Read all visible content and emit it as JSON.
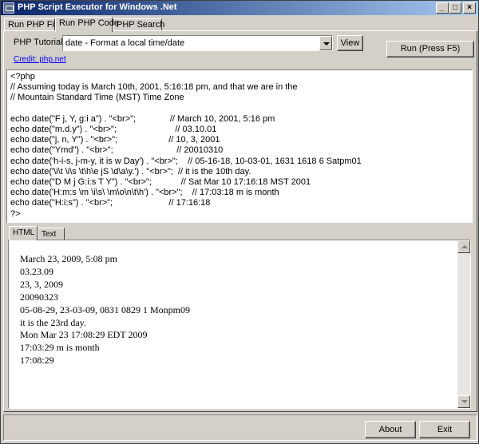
{
  "window": {
    "title": "PHP Script Executor for Windows .Net"
  },
  "titlebar_buttons": {
    "minimize": "_",
    "maximize": "□",
    "close": "×"
  },
  "tabs": [
    "Run PHP File",
    "Run PHP Code",
    "PHP Search"
  ],
  "tutorials": {
    "label": "PHP Tutorials",
    "selected": "date - Format a local time/date",
    "view_button": "View",
    "credit_link": "Credit: php.net"
  },
  "run_button": "Run (Press F5)",
  "code": "<?php\n// Assuming today is March 10th, 2001, 5:16:18 pm, and that we are in the\n// Mountain Standard Time (MST) Time Zone\n\necho date(\"F j, Y, g:i a\") . \"<br>\";              // March 10, 2001, 5:16 pm\necho date(\"m.d.y\") . \"<br>\";                        // 03.10.01\necho date(\"j, n, Y\") . \"<br>\";                     // 10, 3, 2001\necho date(\"Ymd\") . \"<br>\";                          // 20010310\necho date('h-i-s, j-m-y, it is w Day') . \"<br>\";    // 05-16-18, 10-03-01, 1631 1618 6 Satpm01\necho date('\\i\\t \\i\\s \\t\\h\\e jS \\d\\a\\y.') . \"<br>\";  // it is the 10th day.\necho date(\"D M j G:i:s T Y\") . \"<br>\";            // Sat Mar 10 17:16:18 MST 2001\necho date('H:m:s \\m \\i\\s\\ \\m\\o\\n\\t\\h') . \"<br>\";    // 17:03:18 m is month\necho date(\"H:i:s\") . \"<br>\";                       // 17:16:18\n?>",
  "output_tabs": [
    "HTML",
    "Text"
  ],
  "output_lines": [
    "March 23, 2009, 5:08 pm",
    "03.23.09",
    "23, 3, 2009",
    "20090323",
    "05-08-29, 23-03-09, 0831 0829 1 Monpm09",
    "it is the 23rd day.",
    "Mon Mar 23 17:08:29 EDT 2009",
    "17:03:29 m is month",
    "17:08:29"
  ],
  "footer": {
    "about": "About",
    "exit": "Exit"
  }
}
